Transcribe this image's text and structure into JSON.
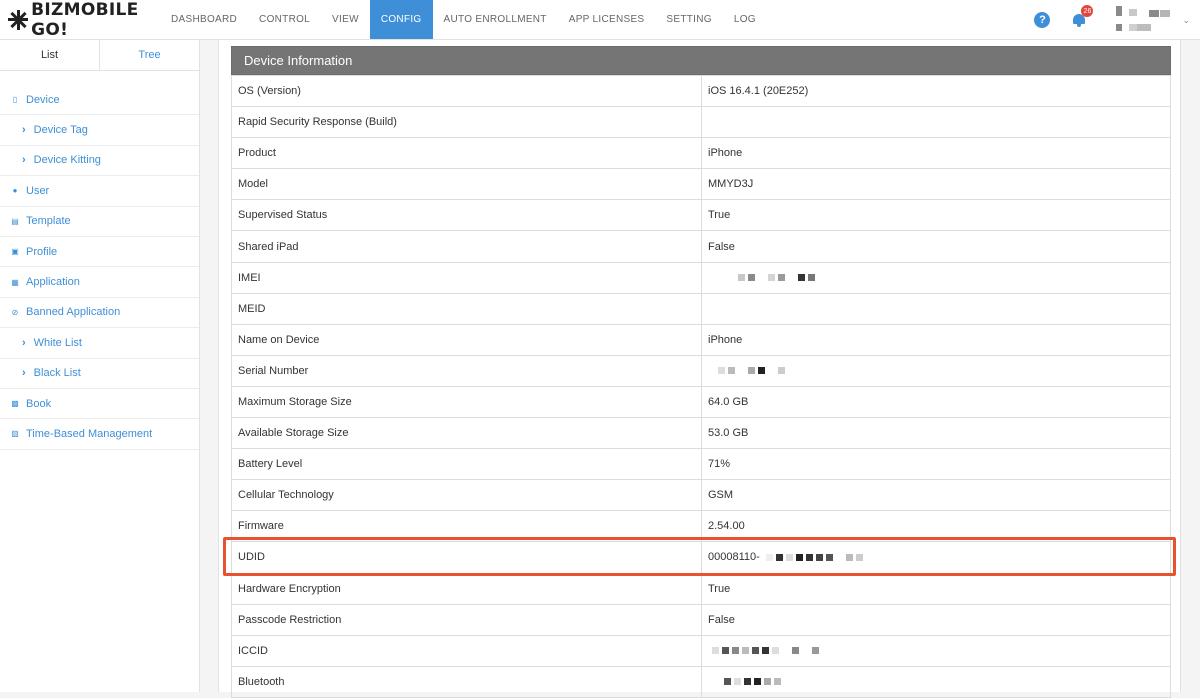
{
  "app": {
    "logo_text": "BIZMOBILE GO!"
  },
  "nav": {
    "items": [
      "DASHBOARD",
      "CONTROL",
      "VIEW",
      "CONFIG",
      "AUTO ENROLLMENT",
      "APP LICENSES",
      "SETTING",
      "LOG"
    ],
    "active": "CONFIG"
  },
  "header": {
    "help_icon": "?",
    "notification_count": "26"
  },
  "sidebar": {
    "tabs": [
      "List",
      "Tree"
    ],
    "items": [
      {
        "label": "Device",
        "icon": "mobile-icon"
      },
      {
        "label": "Device Tag",
        "icon": "chevron-right-icon"
      },
      {
        "label": "Device Kitting",
        "icon": "chevron-right-icon"
      },
      {
        "label": "User",
        "icon": "user-icon"
      },
      {
        "label": "Template",
        "icon": "document-icon"
      },
      {
        "label": "Profile",
        "icon": "briefcase-icon"
      },
      {
        "label": "Application",
        "icon": "grid-icon"
      },
      {
        "label": "Banned Application",
        "icon": "ban-icon"
      },
      {
        "label": "White List",
        "icon": "chevron-right-icon"
      },
      {
        "label": "Black List",
        "icon": "chevron-right-icon"
      },
      {
        "label": "Book",
        "icon": "book-icon"
      },
      {
        "label": "Time-Based Management",
        "icon": "calendar-icon"
      }
    ]
  },
  "device_info": {
    "title": "Device Information",
    "rows": [
      {
        "key": "OS (Version)",
        "value": "iOS 16.4.1 (20E252)"
      },
      {
        "key": "Rapid Security Response (Build)",
        "value": ""
      },
      {
        "key": "Product",
        "value": "iPhone"
      },
      {
        "key": "Model",
        "value": "MMYD3J"
      },
      {
        "key": "Supervised Status",
        "value": "True"
      },
      {
        "key": "Shared iPad",
        "value": "False"
      },
      {
        "key": "IMEI",
        "value": ""
      },
      {
        "key": "MEID",
        "value": ""
      },
      {
        "key": "Name on Device",
        "value": "iPhone"
      },
      {
        "key": "Serial Number",
        "value": ""
      },
      {
        "key": "Maximum Storage Size",
        "value": "64.0 GB"
      },
      {
        "key": "Available Storage Size",
        "value": "53.0 GB"
      },
      {
        "key": "Battery Level",
        "value": "71%"
      },
      {
        "key": "Cellular Technology",
        "value": "GSM"
      },
      {
        "key": "Firmware",
        "value": "2.54.00"
      },
      {
        "key": "UDID",
        "value": "00008110-"
      },
      {
        "key": "Hardware Encryption",
        "value": "True"
      },
      {
        "key": "Passcode Restriction",
        "value": "False"
      },
      {
        "key": "ICCID",
        "value": ""
      },
      {
        "key": "Bluetooth",
        "value": ""
      }
    ]
  },
  "colors": {
    "accent": "#3f8fd8",
    "panel_header": "#757575",
    "highlight": "#e5532f",
    "badge": "#e2453c"
  }
}
